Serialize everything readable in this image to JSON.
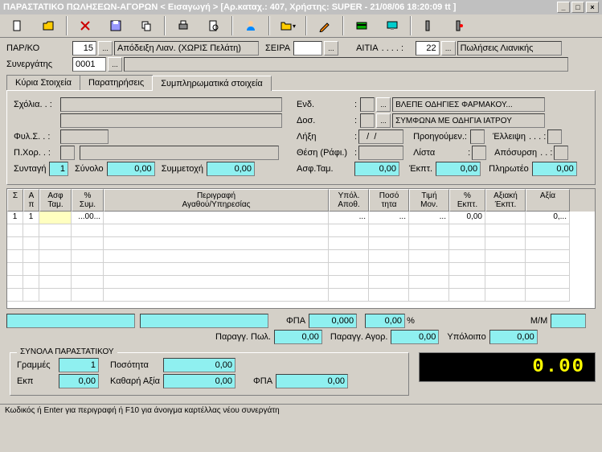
{
  "title": "ΠΑΡΑΣΤΑΤΙΚΟ ΠΩΛΗΣΕΩΝ-ΑΓΟΡΩΝ < Εισαγωγή > [Αρ.καταχ.: 407, Χρήστης: SUPER - 21/08/06 18:20:09 tt ]",
  "header": {
    "parko_lbl": "ΠΑΡ/ΚΟ",
    "parko_val": "15",
    "parko_desc": "Απόδειξη Λιαν. (ΧΩΡΙΣ Πελάτη)",
    "seira_lbl": "ΣΕΙΡΑ",
    "seira_val": "",
    "aitia_lbl": "ΑΙΤΙΑ",
    "aitia_val": "22",
    "aitia_desc": "Πωλήσεις Λιανικής",
    "synergatis_lbl": "Συνεργάτης",
    "synergatis_val": "0001",
    "synergatis_desc": ""
  },
  "tabs": [
    "Κύρια Στοιχεία",
    "Παρατηρήσεις",
    "Συμπληρωματικά στοιχεία"
  ],
  "panel": {
    "sxolia_lbl": "Σχόλια. .  :",
    "fyls_lbl": "Φυλ.Σ. .  :",
    "pxor_lbl": "Π.Χορ.  . :",
    "syntagi_lbl": "Συνταγή",
    "syntagi_val": "1",
    "synolo_lbl": "Σύνολο",
    "synolo_val": "0,00",
    "symmetoxi_lbl": "Συμμετοχή",
    "symmetoxi_val": "0,00",
    "end_lbl": "Ενδ.",
    "end_val": "ΒΛΕΠΕ ΟΔΗΓΙΕΣ ΦΑΡΜΑΚΟΥ...",
    "dos_lbl": "Δοσ.",
    "dos_val": "ΣΥΜΦΩΝΑ ΜΕ ΟΔΗΓΙΑ ΙΑΤΡΟΥ",
    "lixi_lbl": "Λήξη",
    "lixi_val": "  /  /",
    "thesi_lbl": "Θέση (Ράφι.)",
    "asftam_lbl": "Ασφ.Ταμ.",
    "asftam_val": "0,00",
    "proigoumen_lbl": "Προηγούμεν.:",
    "lista_lbl": "Λίστα",
    "ekpt_lbl": "Έκπτ.",
    "ekpt_val": "0,00",
    "elleipsi_lbl": "Έλλειψη",
    "aposyrsi_lbl": "Απόσυρση",
    "pliroteo_lbl": "Πληρωτέο",
    "pliroteo_val": "0,00"
  },
  "grid": {
    "headers": [
      "Σ",
      "Α\nπ",
      "Ασφ\nΤαμ.",
      "%\nΣυμ.",
      "Περιγραφή\nΑγαθού/Υπηρεσίας",
      "Υπόλ.\nΑποθ.",
      "Ποσό\nτητα",
      "Τιμή\nΜον.",
      "%\nΕκπτ.",
      "Αξιακή\nΈκπτ.",
      "Αξία"
    ],
    "row": {
      "s": "1",
      "ap": "1",
      "asf": "",
      "sym": "...00...",
      "desc": "",
      "ypol": "...",
      "posot": "...",
      "timi": "...",
      "ekpt": "0,00",
      "aksekpt": "",
      "aksia": "0,..."
    }
  },
  "mid": {
    "fpa_lbl": "ΦΠΑ",
    "fpa_val": "0,000",
    "pct_val": "0,00",
    "pct_sym": "%",
    "mm_lbl": "Μ/Μ",
    "paraggpol_lbl": "Παραγγ. Πωλ.",
    "paraggpol_val": "0,00",
    "paraggagor_lbl": "Παραγγ. Αγορ.",
    "paraggagor_val": "0,00",
    "ypoloipo_lbl": "Υπόλοιπο",
    "ypoloipo_val": "0,00"
  },
  "totals": {
    "title": "ΣΥΝΟΛΑ ΠΑΡΑΣΤΑΤΙΚΟΥ",
    "grammes_lbl": "Γραμμές",
    "grammes_val": "1",
    "posotita_lbl": "Ποσότητα",
    "posotita_val": "0,00",
    "ekp_lbl": "Εκπ",
    "ekp_val": "0,00",
    "kathari_lbl": "Καθαρή Αξία",
    "kathari_val": "0,00",
    "fpa_lbl": "ΦΠΑ",
    "fpa_val": "0,00",
    "lcd": "0.00"
  },
  "status": "Κωδικός ή Enter για περιγραφή ή F10 για άνοιγμα καρτέλλας νέου συνεργάτη"
}
